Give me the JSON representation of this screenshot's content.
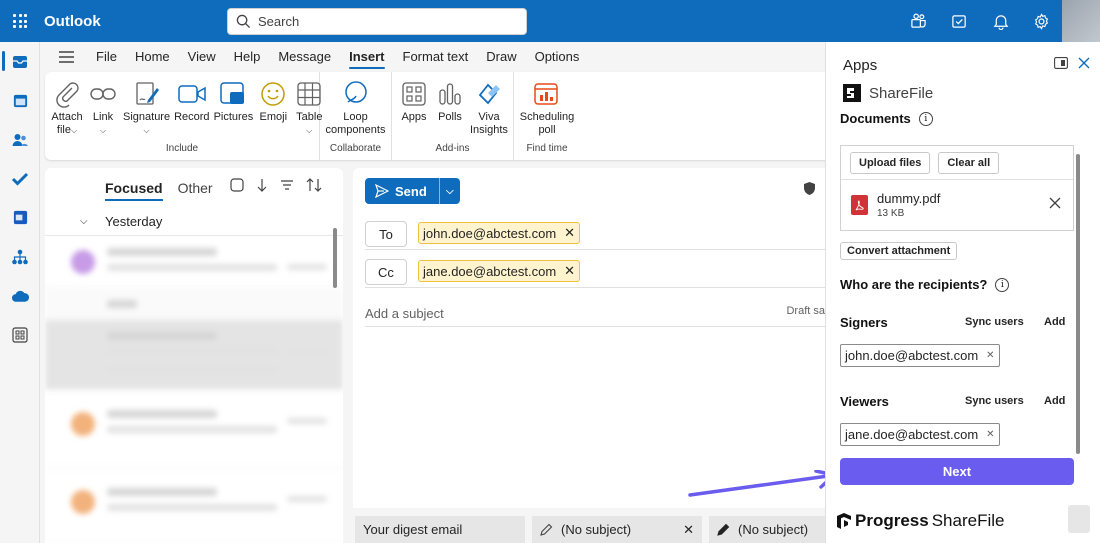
{
  "app": {
    "name": "Outlook"
  },
  "search": {
    "placeholder": "Search"
  },
  "menu": {
    "tabs": [
      "File",
      "Home",
      "View",
      "Help",
      "Message",
      "Insert",
      "Format text",
      "Draw",
      "Options"
    ],
    "active": "Insert"
  },
  "ribbon": {
    "include": {
      "label": "Include",
      "attach_l1": "Attach",
      "attach_l2": "file",
      "link": "Link",
      "signature": "Signature",
      "record": "Record",
      "pictures": "Pictures",
      "emoji": "Emoji",
      "table": "Table"
    },
    "collaborate": {
      "label": "Collaborate",
      "loop_l1": "Loop",
      "loop_l2": "components"
    },
    "addins": {
      "label": "Add-ins",
      "apps": "Apps",
      "polls": "Polls",
      "viva_l1": "Viva",
      "viva_l2": "Insights"
    },
    "findtime": {
      "label": "Find time",
      "sched_l1": "Scheduling",
      "sched_l2": "poll"
    }
  },
  "list": {
    "focused": "Focused",
    "other": "Other",
    "group": "Yesterday"
  },
  "compose": {
    "send": "Send",
    "to_label": "To",
    "cc_label": "Cc",
    "to_email": "john.doe@abctest.com",
    "cc_email": "jane.doe@abctest.com",
    "subject_placeholder": "Add a subject",
    "draft": "Draft sa"
  },
  "bottom_tabs": {
    "digest": "Your digest email",
    "draft1": "(No subject)",
    "draft2": "(No subject)"
  },
  "pane": {
    "title": "Apps",
    "brand": "ShareFile",
    "documents": "Documents",
    "upload": "Upload files",
    "clear": "Clear all",
    "file_name": "dummy.pdf",
    "file_size": "13 KB",
    "convert": "Convert attachment",
    "recipients_q": "Who are the recipients?",
    "signers": "Signers",
    "viewers": "Viewers",
    "sync": "Sync users",
    "add": "Add",
    "signer_email": "john.doe@abctest.com",
    "viewer_email": "jane.doe@abctest.com",
    "next": "Next",
    "footer_brand_1": "Progress",
    "footer_brand_2": "ShareFile"
  },
  "colors": {
    "brand": "#0f6cbd",
    "next": "#6b5cf0",
    "chip": "#fff4ce"
  }
}
